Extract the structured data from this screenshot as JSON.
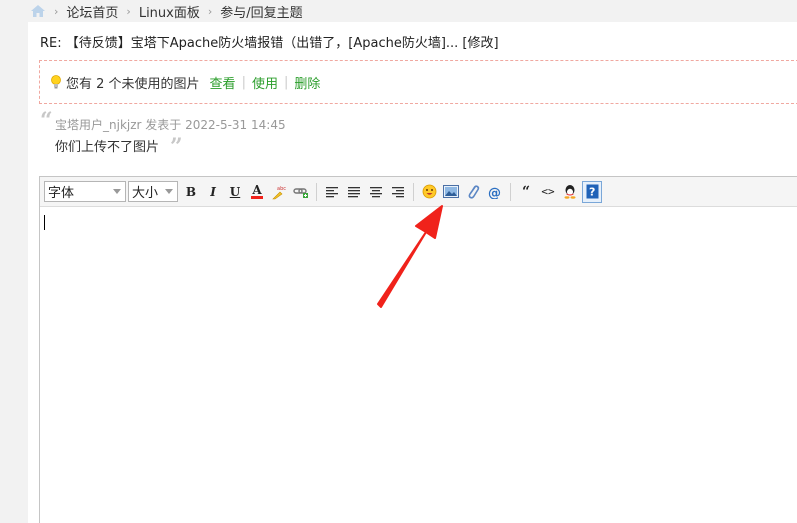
{
  "breadcrumb": {
    "items": [
      "论坛首页",
      "Linux面板",
      "参与/回复主题"
    ],
    "separator": "›"
  },
  "post": {
    "title": "RE: 【待反馈】宝塔下Apache防火墙报错（出错了，[Apache防火墙]... [修改]"
  },
  "notice": {
    "text": "您有 2 个未使用的图片",
    "links": [
      "查看",
      "使用",
      "删除"
    ],
    "separator": "|"
  },
  "quote": {
    "open_mark": "“",
    "meta": "宝塔用户_njkjzr 发表于 2022-5-31 14:45",
    "body": "你们上传不了图片",
    "close_mark": "”"
  },
  "toolbar": {
    "font_select": "字体",
    "size_select": "大小",
    "bold": "B",
    "italic": "I",
    "underline": "U",
    "color": "A",
    "quote_btn": "“",
    "code_btn": "<>"
  },
  "colors": {
    "link_green": "#2a9d2a",
    "notice_border": "#f0a8a0",
    "arrow_red": "#f0221b"
  }
}
